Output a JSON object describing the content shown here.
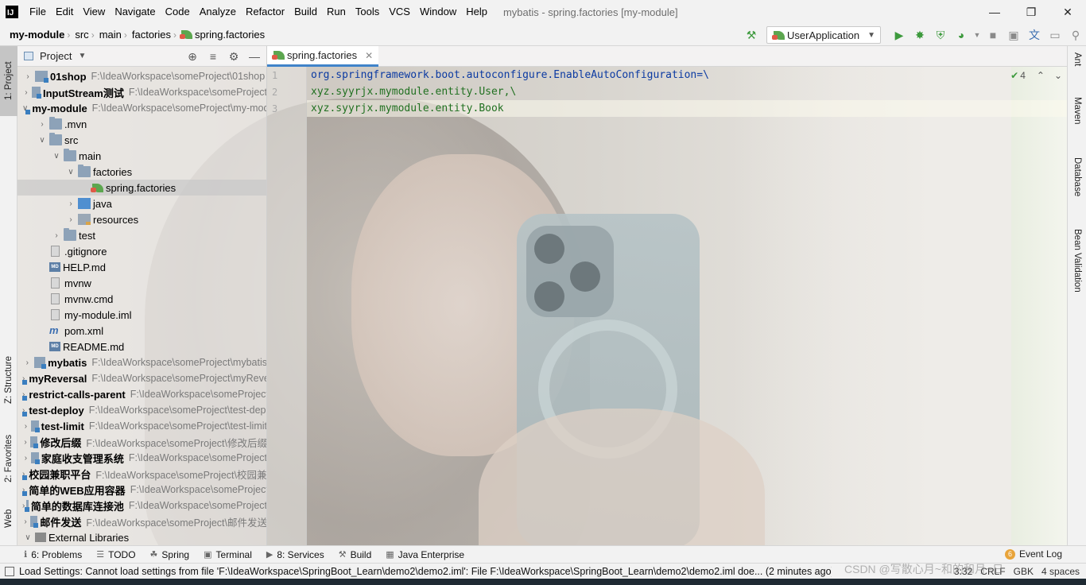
{
  "menu": {
    "items": [
      "File",
      "Edit",
      "View",
      "Navigate",
      "Code",
      "Analyze",
      "Refactor",
      "Build",
      "Run",
      "Tools",
      "VCS",
      "Window",
      "Help"
    ],
    "window_title": "mybatis - spring.factories [my-module]"
  },
  "navbar": {
    "crumbs": [
      "my-module",
      "src",
      "main",
      "factories",
      "spring.factories"
    ],
    "run_config": "UserApplication"
  },
  "left_strip": {
    "project_tab": "1: Project",
    "structure_tab": "Z: Structure",
    "favorites_tab": "2: Favorites",
    "web_tab": "Web"
  },
  "right_strip": {
    "ant": "Ant",
    "maven": "Maven",
    "database": "Database",
    "bean_validation": "Bean Validation"
  },
  "project_panel": {
    "title": "Project",
    "tree": [
      {
        "name": "01shop",
        "path": "F:\\IdeaWorkspace\\someProject\\01shop",
        "bold": true,
        "icon": "module",
        "arrow": "right",
        "indent": 0
      },
      {
        "name": "InputStream测试",
        "path": "F:\\IdeaWorkspace\\someProject",
        "bold": true,
        "icon": "module",
        "arrow": "right",
        "indent": 0
      },
      {
        "name": "my-module",
        "path": "F:\\IdeaWorkspace\\someProject\\my-module",
        "bold": true,
        "icon": "module",
        "arrow": "down",
        "indent": 0
      },
      {
        "name": ".mvn",
        "path": "",
        "bold": false,
        "icon": "folder",
        "arrow": "right",
        "indent": 1
      },
      {
        "name": "src",
        "path": "",
        "bold": false,
        "icon": "folder",
        "arrow": "down",
        "indent": 1
      },
      {
        "name": "main",
        "path": "",
        "bold": false,
        "icon": "folder",
        "arrow": "down",
        "indent": 2
      },
      {
        "name": "factories",
        "path": "",
        "bold": false,
        "icon": "folder",
        "arrow": "down",
        "indent": 3
      },
      {
        "name": "spring.factories",
        "path": "",
        "bold": false,
        "icon": "spring",
        "arrow": "",
        "indent": 4,
        "selected": true
      },
      {
        "name": "java",
        "path": "",
        "bold": false,
        "icon": "src",
        "arrow": "right",
        "indent": 3
      },
      {
        "name": "resources",
        "path": "",
        "bold": false,
        "icon": "res",
        "arrow": "right",
        "indent": 3
      },
      {
        "name": "test",
        "path": "",
        "bold": false,
        "icon": "folder",
        "arrow": "right",
        "indent": 2
      },
      {
        "name": ".gitignore",
        "path": "",
        "bold": false,
        "icon": "file",
        "arrow": "",
        "indent": 1
      },
      {
        "name": "HELP.md",
        "path": "",
        "bold": false,
        "icon": "md",
        "arrow": "",
        "indent": 1
      },
      {
        "name": "mvnw",
        "path": "",
        "bold": false,
        "icon": "file",
        "arrow": "",
        "indent": 1
      },
      {
        "name": "mvnw.cmd",
        "path": "",
        "bold": false,
        "icon": "file",
        "arrow": "",
        "indent": 1
      },
      {
        "name": "my-module.iml",
        "path": "",
        "bold": false,
        "icon": "file",
        "arrow": "",
        "indent": 1
      },
      {
        "name": "pom.xml",
        "path": "",
        "bold": false,
        "icon": "m",
        "arrow": "",
        "indent": 1
      },
      {
        "name": "README.md",
        "path": "",
        "bold": false,
        "icon": "md",
        "arrow": "",
        "indent": 1
      },
      {
        "name": "mybatis",
        "path": "F:\\IdeaWorkspace\\someProject\\mybatis",
        "bold": true,
        "icon": "module",
        "arrow": "right",
        "indent": 0
      },
      {
        "name": "myReversal",
        "path": "F:\\IdeaWorkspace\\someProject\\myReversal",
        "bold": true,
        "icon": "module",
        "arrow": "right",
        "indent": 0
      },
      {
        "name": "restrict-calls-parent",
        "path": "F:\\IdeaWorkspace\\someProject",
        "bold": true,
        "icon": "module",
        "arrow": "right",
        "indent": 0
      },
      {
        "name": "test-deploy",
        "path": "F:\\IdeaWorkspace\\someProject\\test-deploy",
        "bold": true,
        "icon": "module",
        "arrow": "right",
        "indent": 0
      },
      {
        "name": "test-limit",
        "path": "F:\\IdeaWorkspace\\someProject\\test-limit",
        "bold": true,
        "icon": "module",
        "arrow": "right",
        "indent": 0
      },
      {
        "name": "修改后缀",
        "path": "F:\\IdeaWorkspace\\someProject\\修改后缀",
        "bold": true,
        "icon": "module",
        "arrow": "right",
        "indent": 0
      },
      {
        "name": "家庭收支管理系统",
        "path": "F:\\IdeaWorkspace\\someProject",
        "bold": true,
        "icon": "module",
        "arrow": "right",
        "indent": 0
      },
      {
        "name": "校园兼职平台",
        "path": "F:\\IdeaWorkspace\\someProject\\校园兼职平台",
        "bold": true,
        "icon": "module",
        "arrow": "right",
        "indent": 0
      },
      {
        "name": "简单的WEB应用容器",
        "path": "F:\\IdeaWorkspace\\someProject",
        "bold": true,
        "icon": "module",
        "arrow": "right",
        "indent": 0
      },
      {
        "name": "简单的数据库连接池",
        "path": "F:\\IdeaWorkspace\\someProject",
        "bold": true,
        "icon": "module",
        "arrow": "right",
        "indent": 0
      },
      {
        "name": "邮件发送",
        "path": "F:\\IdeaWorkspace\\someProject\\邮件发送",
        "bold": true,
        "icon": "module",
        "arrow": "right",
        "indent": 0
      },
      {
        "name": "External Libraries",
        "path": "",
        "bold": false,
        "icon": "libs",
        "arrow": "down",
        "indent": 0
      }
    ]
  },
  "editor": {
    "tab_label": "spring.factories",
    "line_numbers": [
      "1",
      "2",
      "3"
    ],
    "lines": [
      {
        "text": "org.springframework.boot.autoconfigure.EnableAutoConfiguration=\\",
        "kind": "key"
      },
      {
        "text": "xyz.syyrjx.mymodule.entity.User,\\",
        "kind": "val"
      },
      {
        "text": "xyz.syyrjx.mymodule.entity.Book",
        "kind": "val"
      }
    ],
    "inspection_count": "4"
  },
  "bottom_tools": [
    {
      "label": "6: Problems",
      "icon": "info-icon"
    },
    {
      "label": "TODO",
      "icon": "list-icon"
    },
    {
      "label": "Spring",
      "icon": "spring-icon"
    },
    {
      "label": "Terminal",
      "icon": "terminal-icon"
    },
    {
      "label": "8: Services",
      "icon": "services-icon"
    },
    {
      "label": "Build",
      "icon": "hammer-icon"
    },
    {
      "label": "Java Enterprise",
      "icon": "java-ee-icon"
    }
  ],
  "event_log": {
    "count": "6",
    "label": "Event Log"
  },
  "status": {
    "message": "Load Settings: Cannot load settings from file 'F:\\IdeaWorkspace\\SpringBoot_Learn\\demo2\\demo2.iml': File F:\\IdeaWorkspace\\SpringBoot_Learn\\demo2\\demo2.iml doe... (2 minutes ago)",
    "position": "3:32",
    "line_sep": "CRLF",
    "encoding": "GBK",
    "indent": "4 spaces",
    "watermark": "CSDN @写散心月~和的和月~日"
  },
  "colors": {
    "accent": "#4083c9",
    "run_green": "#3d9a3d",
    "code_key": "#0b3aa2",
    "code_value": "#207020"
  }
}
